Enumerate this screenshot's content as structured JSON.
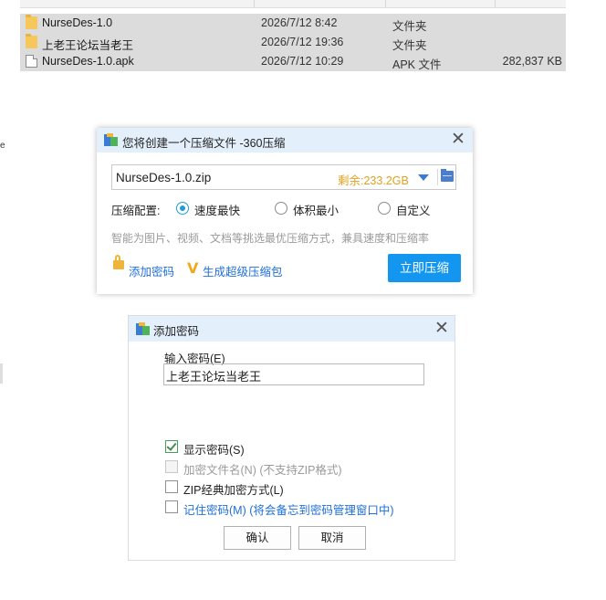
{
  "explorer": {
    "files": [
      {
        "name": "NurseDes-1.0",
        "date": "2026/7/12 8:42",
        "type": "文件夹",
        "size": "",
        "icon": "folder-icon"
      },
      {
        "name": "上老王论坛当老王",
        "date": "2026/7/12 19:36",
        "type": "文件夹",
        "size": "",
        "icon": "folder-icon"
      },
      {
        "name": "NurseDes-1.0.apk",
        "date": "2026/7/12 10:29",
        "type": "APK 文件",
        "size": "282,837 KB",
        "icon": "file-icon"
      }
    ],
    "edge_char": "e"
  },
  "compress_dialog": {
    "title": "您将创建一个压缩文件 -360压缩",
    "archive_name": "NurseDes-1.0.zip",
    "free_space": "剩余:233.2GB",
    "config_label": "压缩配置:",
    "options": [
      {
        "label": "速度最快",
        "selected": true
      },
      {
        "label": "体积最小",
        "selected": false
      },
      {
        "label": "自定义",
        "selected": false
      }
    ],
    "hint": "智能为图片、视频、文档等挑选最优压缩方式，兼具速度和压缩率",
    "add_password": "添加密码",
    "super_pack": "生成超级压缩包",
    "compress_button": "立即压缩",
    "accent_color": "#1296f0"
  },
  "password_dialog": {
    "title": "添加密码",
    "input_label": "输入密码(E)",
    "password_value": "上老王论坛当老王",
    "checkboxes": [
      {
        "label": "显示密码(S)",
        "checked": true,
        "enabled": true
      },
      {
        "label": "加密文件名(N) (不支持ZIP格式)",
        "checked": false,
        "enabled": false
      },
      {
        "label": "ZIP经典加密方式(L)",
        "checked": false,
        "enabled": true
      },
      {
        "label": "记住密码(M) (将会备忘到密码管理窗口中)",
        "checked": false,
        "enabled": true
      }
    ],
    "ok_button": "确认",
    "cancel_button": "取消"
  }
}
